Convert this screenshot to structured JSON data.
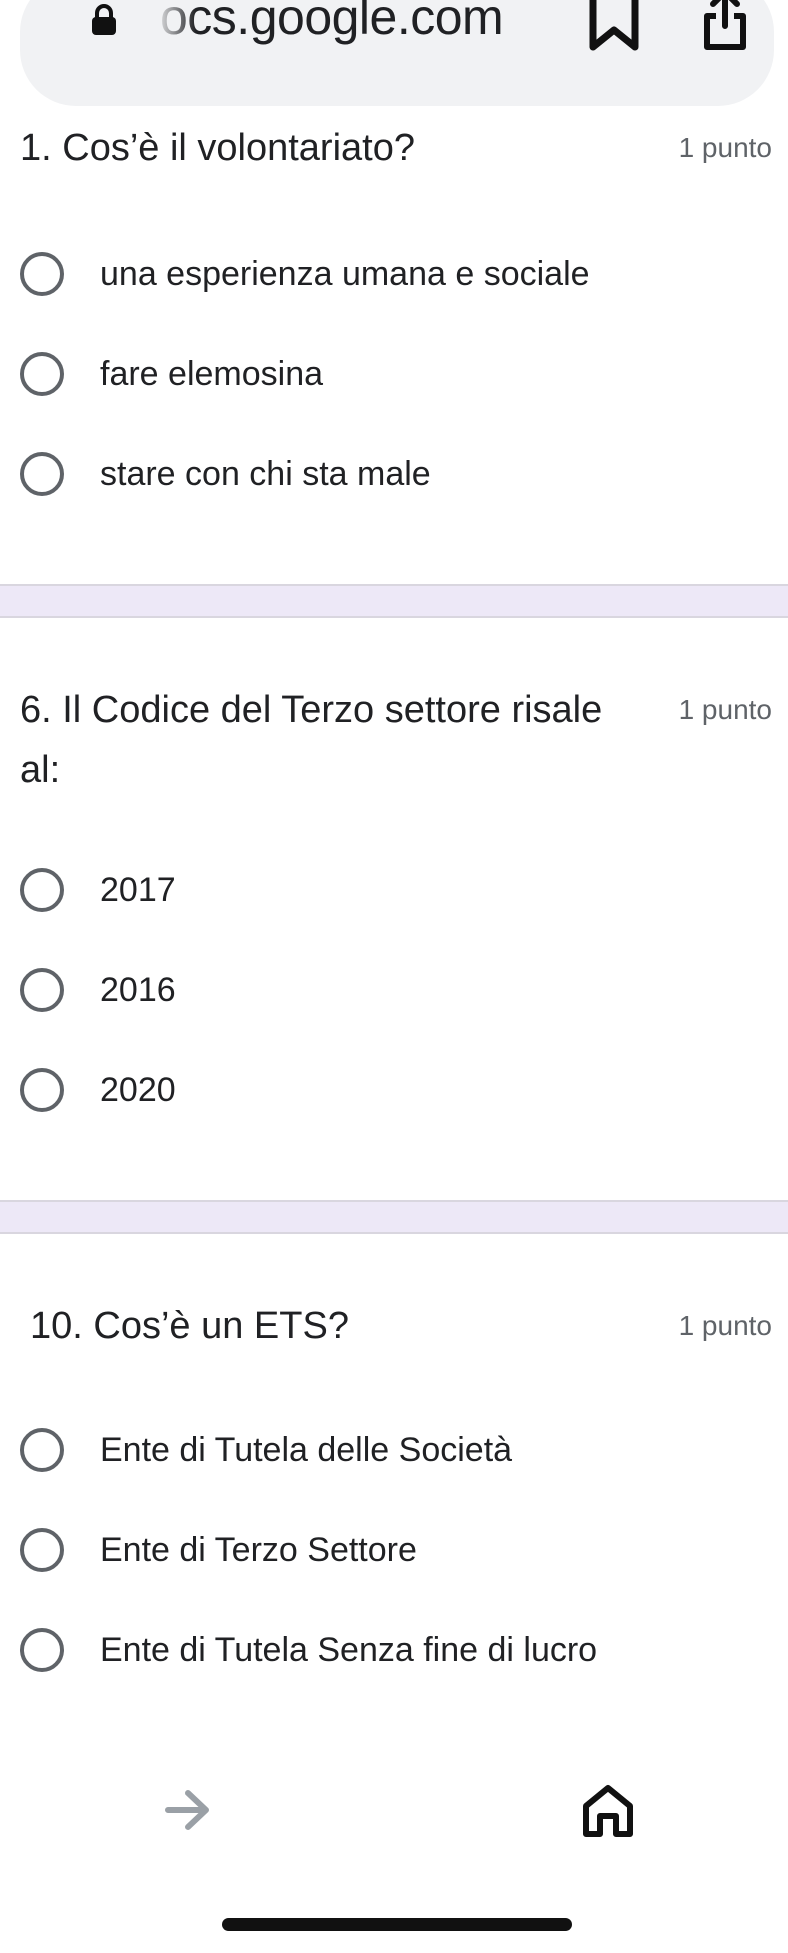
{
  "browser": {
    "url_text": "ocs.google.com",
    "icons": {
      "lock": "lock-icon",
      "bookmark": "bookmark-icon",
      "share": "share-icon",
      "forward": "forward-arrow-icon",
      "home": "home-icon"
    }
  },
  "questions": [
    {
      "title": "1. Cos’è il volontariato?",
      "points": "1 punto",
      "options": [
        "una esperienza umana e sociale",
        "fare elemosina",
        "stare con chi sta male"
      ]
    },
    {
      "title": "6. Il Codice del Terzo settore risale al:",
      "points": "1 punto",
      "options": [
        "2017",
        "2016",
        "2020"
      ]
    },
    {
      "title": "10. Cos’è un ETS?",
      "points": "1 punto",
      "options": [
        "Ente di Tutela delle Società",
        "Ente di Terzo Settore",
        "Ente di Tutela Senza fine di lucro"
      ]
    }
  ],
  "colors": {
    "divider": "#ede8f7",
    "radio_border": "#5f6368",
    "points_text": "#5f6368",
    "forward_disabled": "#9aa0a6"
  }
}
